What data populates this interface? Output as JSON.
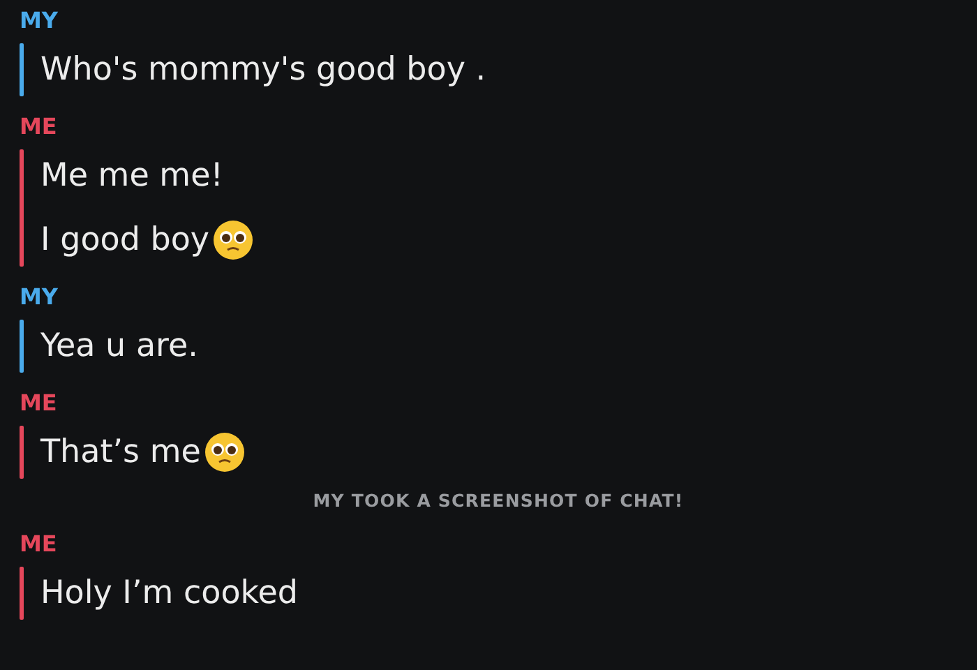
{
  "items": [
    {
      "kind": "group",
      "sender": "MY",
      "color": "#4aabec",
      "messages": [
        {
          "text": "Who's mommy's good boy .",
          "emoji": false
        }
      ]
    },
    {
      "kind": "group",
      "sender": "ME",
      "color": "#e5475b",
      "messages": [
        {
          "text": "Me me me!",
          "emoji": false
        },
        {
          "text": "I good boy",
          "emoji": true
        }
      ]
    },
    {
      "kind": "group",
      "sender": "MY",
      "color": "#4aabec",
      "messages": [
        {
          "text": "Yea u are.",
          "emoji": false
        }
      ]
    },
    {
      "kind": "group",
      "sender": "ME",
      "color": "#e5475b",
      "messages": [
        {
          "text": "That’s me",
          "emoji": true
        }
      ]
    },
    {
      "kind": "notice",
      "text": "MY TOOK A SCREENSHOT OF CHAT!"
    },
    {
      "kind": "group",
      "sender": "ME",
      "color": "#e5475b",
      "messages": [
        {
          "text": "Holy I’m cooked",
          "emoji": false
        }
      ]
    }
  ]
}
